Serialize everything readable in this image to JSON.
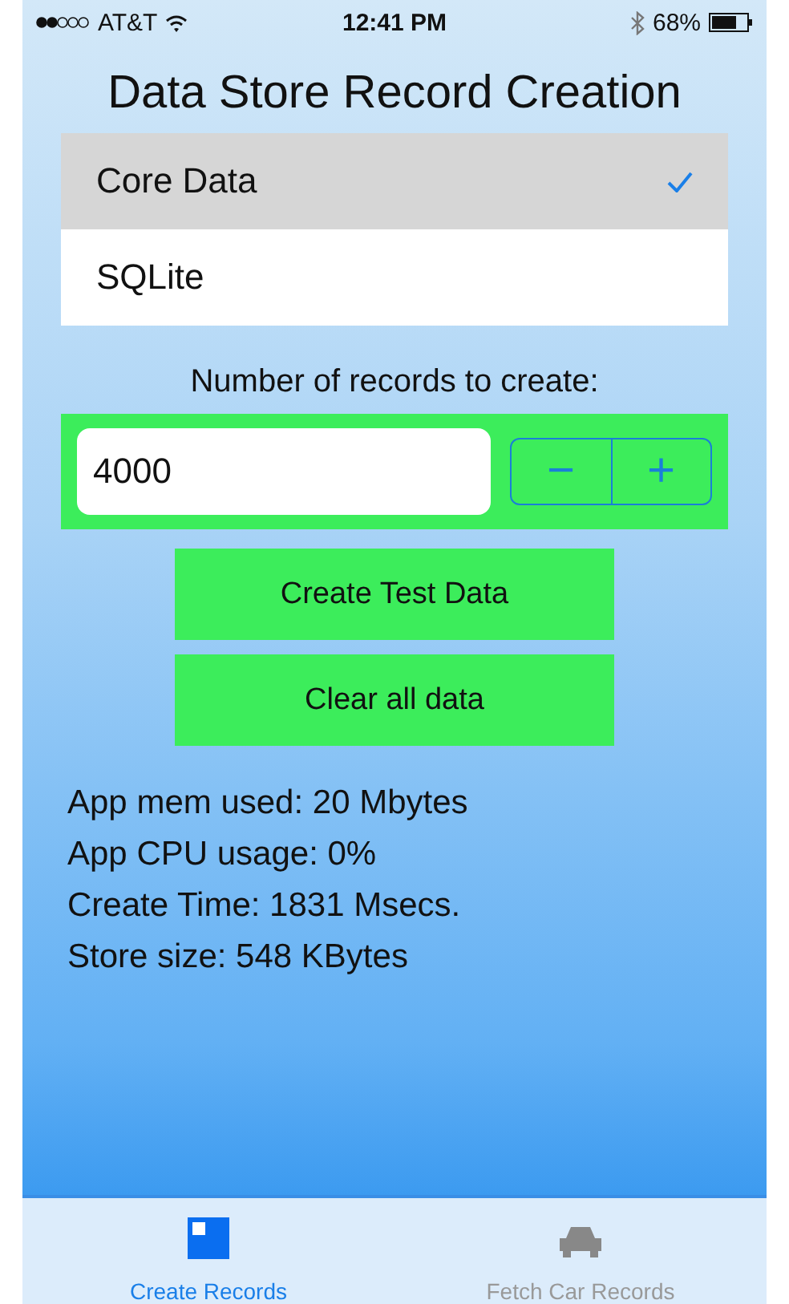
{
  "status_bar": {
    "carrier": "AT&T",
    "time": "12:41 PM",
    "battery": "68%"
  },
  "title": "Data Store Record Creation",
  "stores": [
    {
      "label": "Core Data",
      "selected": true
    },
    {
      "label": "SQLite",
      "selected": false
    }
  ],
  "records": {
    "label": "Number of records to create:",
    "value": "4000",
    "decrement": "−",
    "increment": "+"
  },
  "buttons": [
    "Create Test Data",
    "Clear all data"
  ],
  "stats": [
    "App mem used: 20 Mbytes",
    "App CPU usage: 0%",
    "Create Time: 1831 Msecs.",
    "Store size: 548 KBytes"
  ],
  "tabs": [
    {
      "label": "Create Records",
      "kind": "square",
      "selected": true
    },
    {
      "label": "Fetch Car Records",
      "kind": "car",
      "selected": false
    }
  ]
}
